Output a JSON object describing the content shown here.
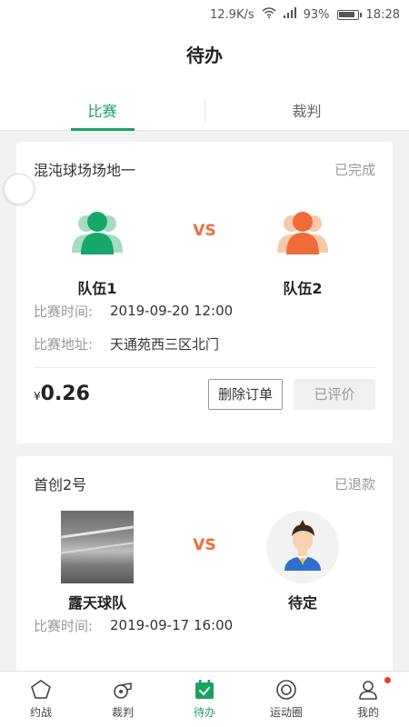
{
  "statusbar": {
    "speed": "12.9K/s",
    "battery": "93%",
    "battery_level": 0.93,
    "time": "18:28",
    "icons": [
      "wifi-icon",
      "signal-icon",
      "battery-icon"
    ]
  },
  "header": {
    "title": "待办"
  },
  "tabs": [
    {
      "label": "比赛",
      "active": true
    },
    {
      "label": "裁判",
      "active": false
    }
  ],
  "orders": [
    {
      "venue": "混沌球场场地一",
      "status": "已完成",
      "team_left": {
        "name": "队伍1",
        "avatar": "team-green-avatar-icon"
      },
      "vs": "VS",
      "team_right": {
        "name": "队伍2",
        "avatar": "team-orange-avatar-icon"
      },
      "time_label": "比赛时间:",
      "time_value": "2019-09-20 12:00",
      "address_label": "比赛地址:",
      "address_value": "天通苑西三区北门",
      "currency": "¥",
      "price": "0.26",
      "delete_label": "删除订单",
      "rated_label": "已评价"
    },
    {
      "venue": "首创2号",
      "status": "已退款",
      "team_left": {
        "name": "露天球队",
        "avatar": "team-photo"
      },
      "vs": "VS",
      "team_right": {
        "name": "待定",
        "avatar": "person-avatar-icon"
      },
      "time_label": "比赛时间:",
      "time_value": "2019-09-17 16:00"
    }
  ],
  "tabbar": [
    {
      "label": "约战",
      "icon": "pentagon-icon",
      "active": false
    },
    {
      "label": "裁判",
      "icon": "whistle-icon",
      "active": false
    },
    {
      "label": "待办",
      "icon": "calendar-check-icon",
      "active": true
    },
    {
      "label": "运动圈",
      "icon": "circle-target-icon",
      "active": false
    },
    {
      "label": "我的",
      "icon": "user-icon",
      "active": false,
      "badge": true
    }
  ],
  "colors": {
    "accent": "#1aa260",
    "vs": "#ef6c3a",
    "team_left": "#16a86a",
    "team_right": "#ef6c3a"
  }
}
